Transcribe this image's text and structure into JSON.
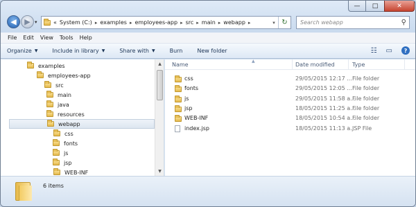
{
  "window": {
    "controls": {
      "minimize": "—",
      "maximize": "□",
      "close": "✕"
    }
  },
  "nav": {
    "back_glyph": "◀",
    "forward_glyph": "▶",
    "recent_glyph": "▾"
  },
  "address": {
    "lead": "«",
    "crumbs": [
      "System (C:)",
      "examples",
      "employees-app",
      "src",
      "main",
      "webapp"
    ],
    "separator": "▸",
    "dropdown_glyph": "▾",
    "refresh_glyph": "↻"
  },
  "search": {
    "placeholder": "Search webapp",
    "icon_glyph": "⚲"
  },
  "menu": {
    "items": [
      "File",
      "Edit",
      "View",
      "Tools",
      "Help"
    ]
  },
  "command_bar": {
    "items": [
      {
        "label": "Organize",
        "dropdown": true
      },
      {
        "label": "Include in library",
        "dropdown": true
      },
      {
        "label": "Share with",
        "dropdown": true
      },
      {
        "label": "Burn",
        "dropdown": false
      },
      {
        "label": "New folder",
        "dropdown": false
      }
    ],
    "views_glyph": "☷",
    "preview_glyph": "▭",
    "help_glyph": "?"
  },
  "tree": {
    "items": [
      {
        "label": "examples",
        "selected": false
      },
      {
        "label": "employees-app",
        "selected": false
      },
      {
        "label": "src",
        "selected": false
      },
      {
        "label": "main",
        "selected": false
      },
      {
        "label": "java",
        "selected": false
      },
      {
        "label": "resources",
        "selected": false
      },
      {
        "label": "webapp",
        "selected": true
      },
      {
        "label": "css",
        "selected": false
      },
      {
        "label": "fonts",
        "selected": false
      },
      {
        "label": "js",
        "selected": false
      },
      {
        "label": "jsp",
        "selected": false
      },
      {
        "label": "WEB-INF",
        "selected": false
      }
    ]
  },
  "columns": {
    "name": "Name",
    "date": "Date modified",
    "type": "Type",
    "sort_glyph": "▲"
  },
  "files": [
    {
      "name": "css",
      "date": "29/05/2015 12:17 ...",
      "type": "File folder",
      "icon": "folder-icon"
    },
    {
      "name": "fonts",
      "date": "29/05/2015 12:05 ...",
      "type": "File folder",
      "icon": "folder-icon"
    },
    {
      "name": "js",
      "date": "29/05/2015 11:58 a...",
      "type": "File folder",
      "icon": "folder-icon"
    },
    {
      "name": "jsp",
      "date": "18/05/2015 11:25 a...",
      "type": "File folder",
      "icon": "folder-icon"
    },
    {
      "name": "WEB-INF",
      "date": "18/05/2015 10:54 a...",
      "type": "File folder",
      "icon": "folder-icon"
    },
    {
      "name": "index.jsp",
      "date": "18/05/2015 11:13 a...",
      "type": "JSP File",
      "icon": "file-icon"
    }
  ],
  "status": {
    "item_count": "6 items"
  }
}
